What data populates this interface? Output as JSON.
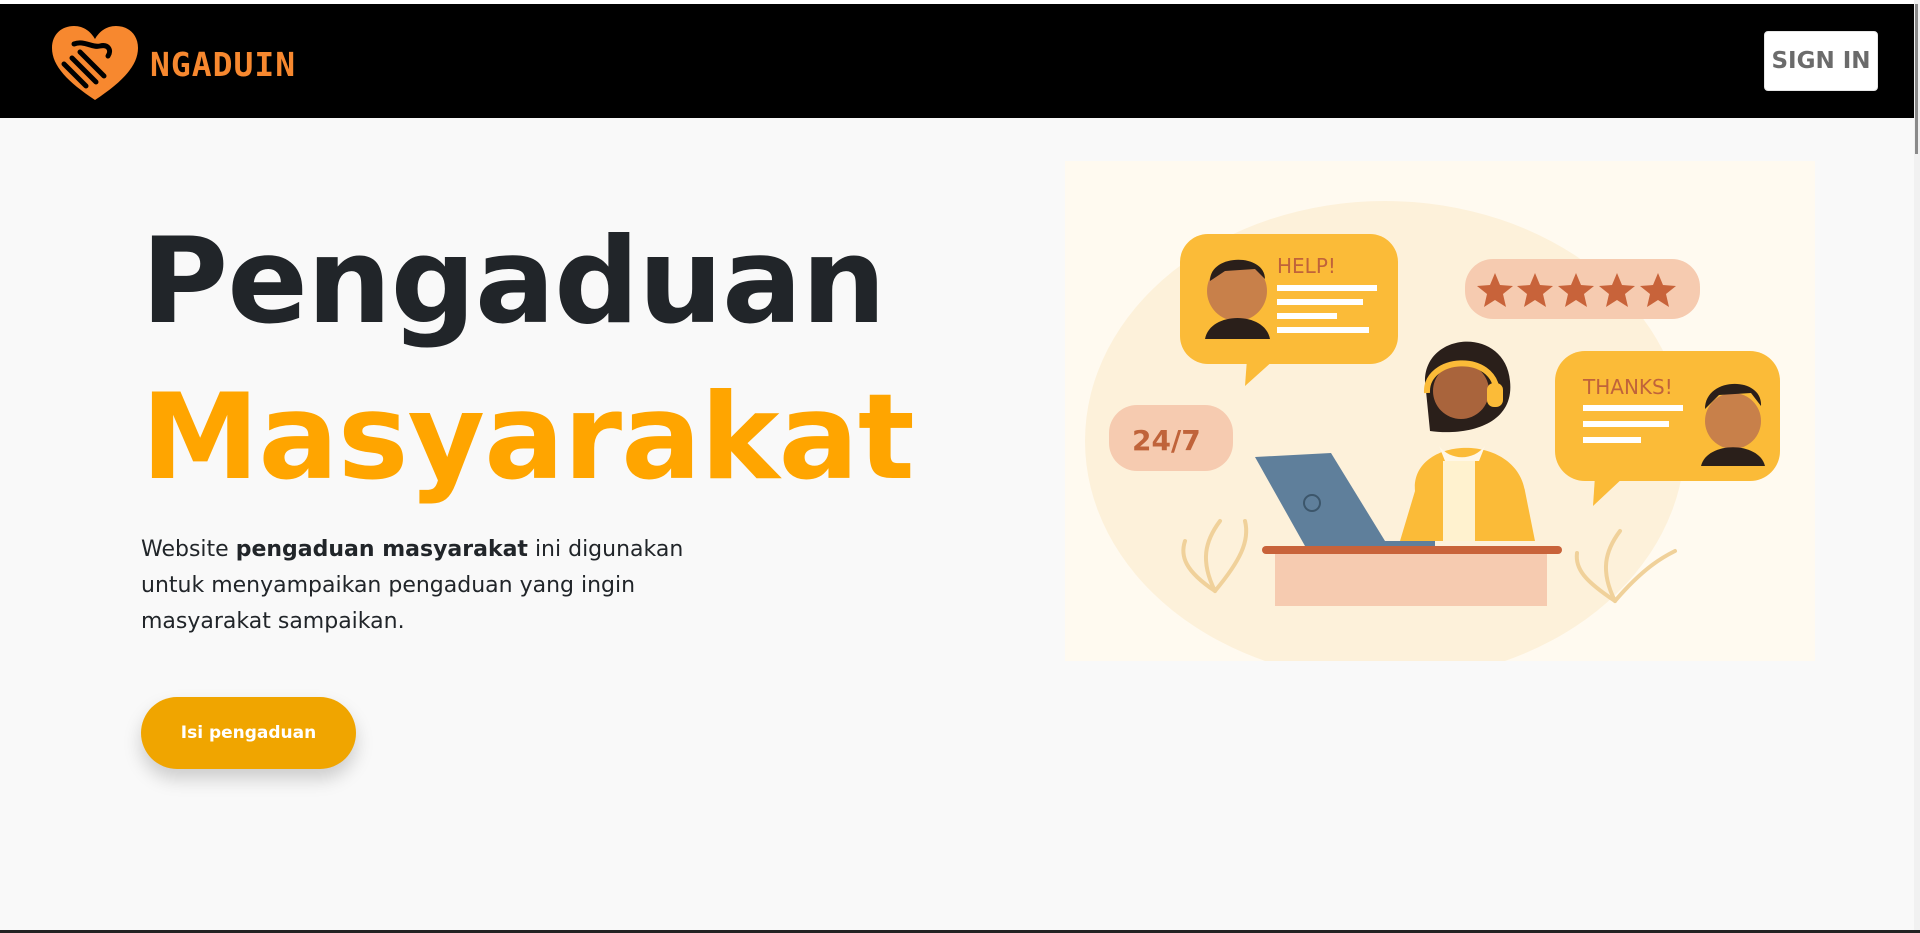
{
  "header": {
    "brand_name": "NGADUIN",
    "signin_label": "SIGN IN"
  },
  "hero": {
    "title_line1": "Pengaduan",
    "title_line2": "Masyarakat",
    "desc_prefix": "Website ",
    "desc_bold": "pengaduan masyarakat",
    "desc_suffix": " ini digunakan untuk menyampaikan pengaduan yang ingin masyarakat sampaikan.",
    "cta_label": "Isi pengaduan"
  },
  "illustration": {
    "bubble_help": "HELP!",
    "bubble_thanks": "THANKS!",
    "badge_247": "24/7",
    "rating_stars": 5
  },
  "colors": {
    "accent": "#ffa500",
    "brand": "#f7882f",
    "navbar": "#000000"
  }
}
